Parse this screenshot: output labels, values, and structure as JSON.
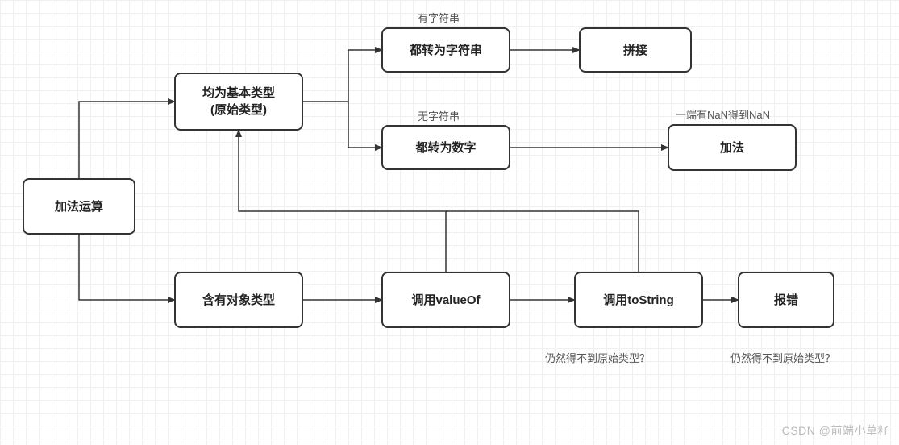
{
  "nodes": {
    "start": "加法运算",
    "primitive": "均为基本类型\n(原始类型)",
    "object": "含有对象类型",
    "toStr": "都转为字符串",
    "toNum": "都转为数字",
    "concat": "拼接",
    "add": "加法",
    "valueOf": "调用valueOf",
    "toString": "调用toString",
    "error": "报错"
  },
  "labels": {
    "hasStr": "有字符串",
    "noStr": "无字符串",
    "nan": "一端有NaN得到NaN",
    "q1": "仍然得不到原始类型？",
    "q2": "仍然得不到原始类型？"
  },
  "watermark": "CSDN @前端小草籽"
}
